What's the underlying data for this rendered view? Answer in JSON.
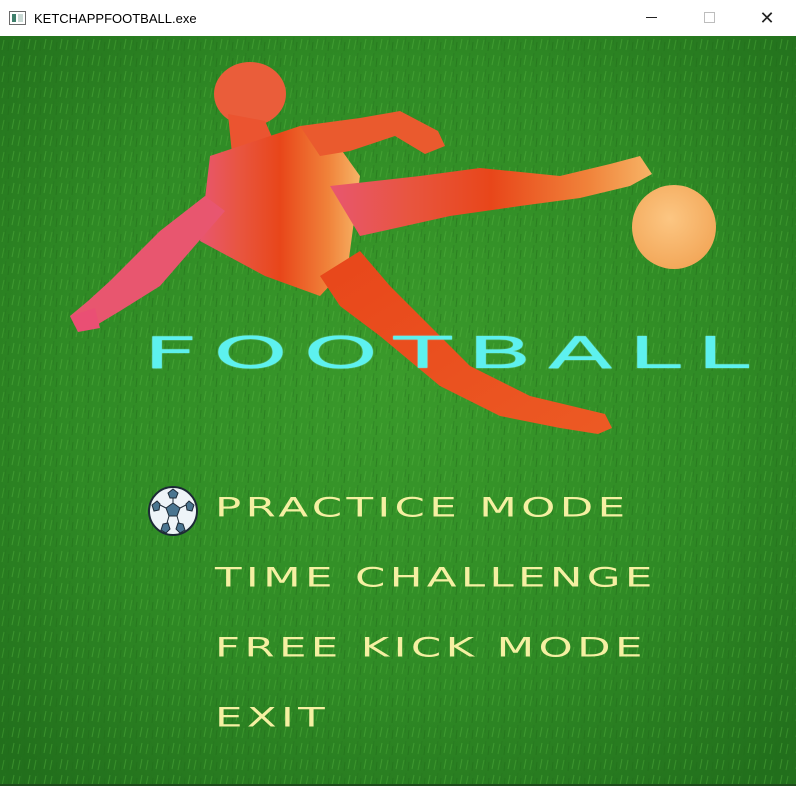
{
  "window": {
    "title": "KETCHAPPFOOTBALL.exe",
    "close_glyph": "✕"
  },
  "icons": {
    "app": "app-icon",
    "minimize": "minimize-icon",
    "maximize": "maximize-icon",
    "close": "close-icon",
    "player": "footballer-silhouette-icon",
    "ball": "ball-icon",
    "cursor": "soccer-ball-icon"
  },
  "colors": {
    "grass": "#2f8a25",
    "logo": "#5df1ef",
    "menu_text": "#f5f0a2",
    "player_top": "#e84a1a",
    "player_left": "#e85a7a",
    "ball": "#f8b56a"
  },
  "game": {
    "logo": "FOOTBALL",
    "menu": [
      {
        "label": "PRACTICE MODE",
        "selected": true
      },
      {
        "label": "TIME CHALLENGE",
        "selected": false
      },
      {
        "label": "FREE KICK MODE",
        "selected": false
      },
      {
        "label": "EXIT",
        "selected": false
      }
    ]
  }
}
